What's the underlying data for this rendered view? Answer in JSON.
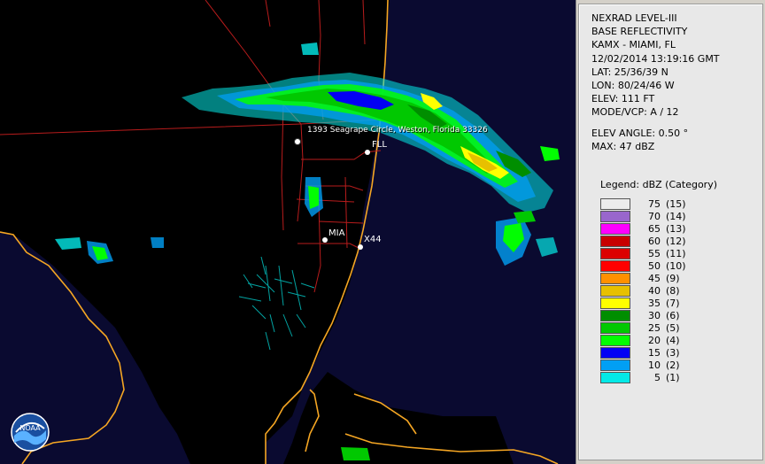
{
  "info": {
    "line1": "NEXRAD LEVEL-III",
    "line2": "BASE REFLECTIVITY",
    "line3": "KAMX - MIAMI, FL",
    "line4": "12/02/2014 13:19:16 GMT",
    "line5": "LAT: 25/36/39 N",
    "line6": "LON: 80/24/46 W",
    "line7": "ELEV: 111 FT",
    "line8": "MODE/VCP: A / 12",
    "line9": "ELEV ANGLE: 0.50 °",
    "line10": "MAX: 47 dBZ"
  },
  "legend": {
    "title": "Legend: dBZ (Category)",
    "items": [
      {
        "value": "75",
        "cat": "(15)",
        "color": "#ececec"
      },
      {
        "value": "70",
        "cat": "(14)",
        "color": "#9966cc"
      },
      {
        "value": "65",
        "cat": "(13)",
        "color": "#ff00ff"
      },
      {
        "value": "60",
        "cat": "(12)",
        "color": "#c80000"
      },
      {
        "value": "55",
        "cat": "(11)",
        "color": "#dc0000"
      },
      {
        "value": "50",
        "cat": "(10)",
        "color": "#ff0000"
      },
      {
        "value": "45",
        "cat": "(9)",
        "color": "#ff9000"
      },
      {
        "value": "40",
        "cat": "(8)",
        "color": "#e7c000"
      },
      {
        "value": "35",
        "cat": "(7)",
        "color": "#ffff00"
      },
      {
        "value": "30",
        "cat": "(6)",
        "color": "#008e00"
      },
      {
        "value": "25",
        "cat": "(5)",
        "color": "#01c801"
      },
      {
        "value": "20",
        "cat": "(4)",
        "color": "#02fd02"
      },
      {
        "value": "15",
        "cat": "(3)",
        "color": "#0300f4"
      },
      {
        "value": "10",
        "cat": "(2)",
        "color": "#019ff4"
      },
      {
        "value": "5",
        "cat": "(1)",
        "color": "#04e9e7"
      }
    ]
  },
  "map": {
    "address_label": "1393 Seagrape Circle, Weston, Florida 33326",
    "sites": {
      "fll": "FLL",
      "mia": "MIA",
      "x44": "X44"
    },
    "coast_color": "#f5a623",
    "road_color": "#b81c1c"
  },
  "logo": {
    "text": "NOAA"
  }
}
